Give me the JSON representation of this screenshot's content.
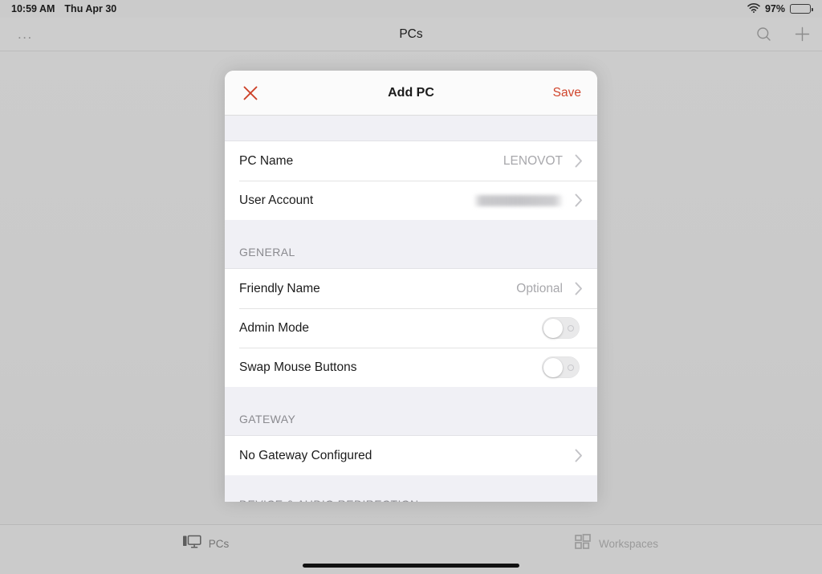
{
  "status_bar": {
    "time": "10:59 AM",
    "date": "Thu Apr 30",
    "battery_percent": "97%",
    "wifi_icon": "wifi-icon",
    "battery_icon": "battery-icon"
  },
  "nav_bar": {
    "more_label": "...",
    "title": "PCs",
    "search_icon": "search-icon",
    "add_icon": "plus-icon"
  },
  "sheet": {
    "close_icon": "close-icon",
    "title": "Add PC",
    "save_label": "Save",
    "accent_color": "#d0452c",
    "sections": [
      {
        "header": "",
        "rows": [
          {
            "label": "PC Name",
            "value": "LENOVOT",
            "type": "disclosure"
          },
          {
            "label": "User Account",
            "value": "",
            "type": "redacted"
          }
        ]
      },
      {
        "header": "GENERAL",
        "rows": [
          {
            "label": "Friendly Name",
            "value": "Optional",
            "type": "disclosure"
          },
          {
            "label": "Admin Mode",
            "value": "off",
            "type": "toggle"
          },
          {
            "label": "Swap Mouse Buttons",
            "value": "off",
            "type": "toggle"
          }
        ]
      },
      {
        "header": "GATEWAY",
        "rows": [
          {
            "label": "No Gateway Configured",
            "value": "",
            "type": "disclosure"
          }
        ]
      }
    ],
    "cut_off_section_header": "DEVICE & AUDIO REDIRECTION"
  },
  "tab_bar": {
    "tabs": [
      {
        "label": "PCs",
        "icon": "desktop-pc-icon",
        "selected": true
      },
      {
        "label": "Workspaces",
        "icon": "workspaces-grid-icon",
        "selected": false
      }
    ]
  }
}
